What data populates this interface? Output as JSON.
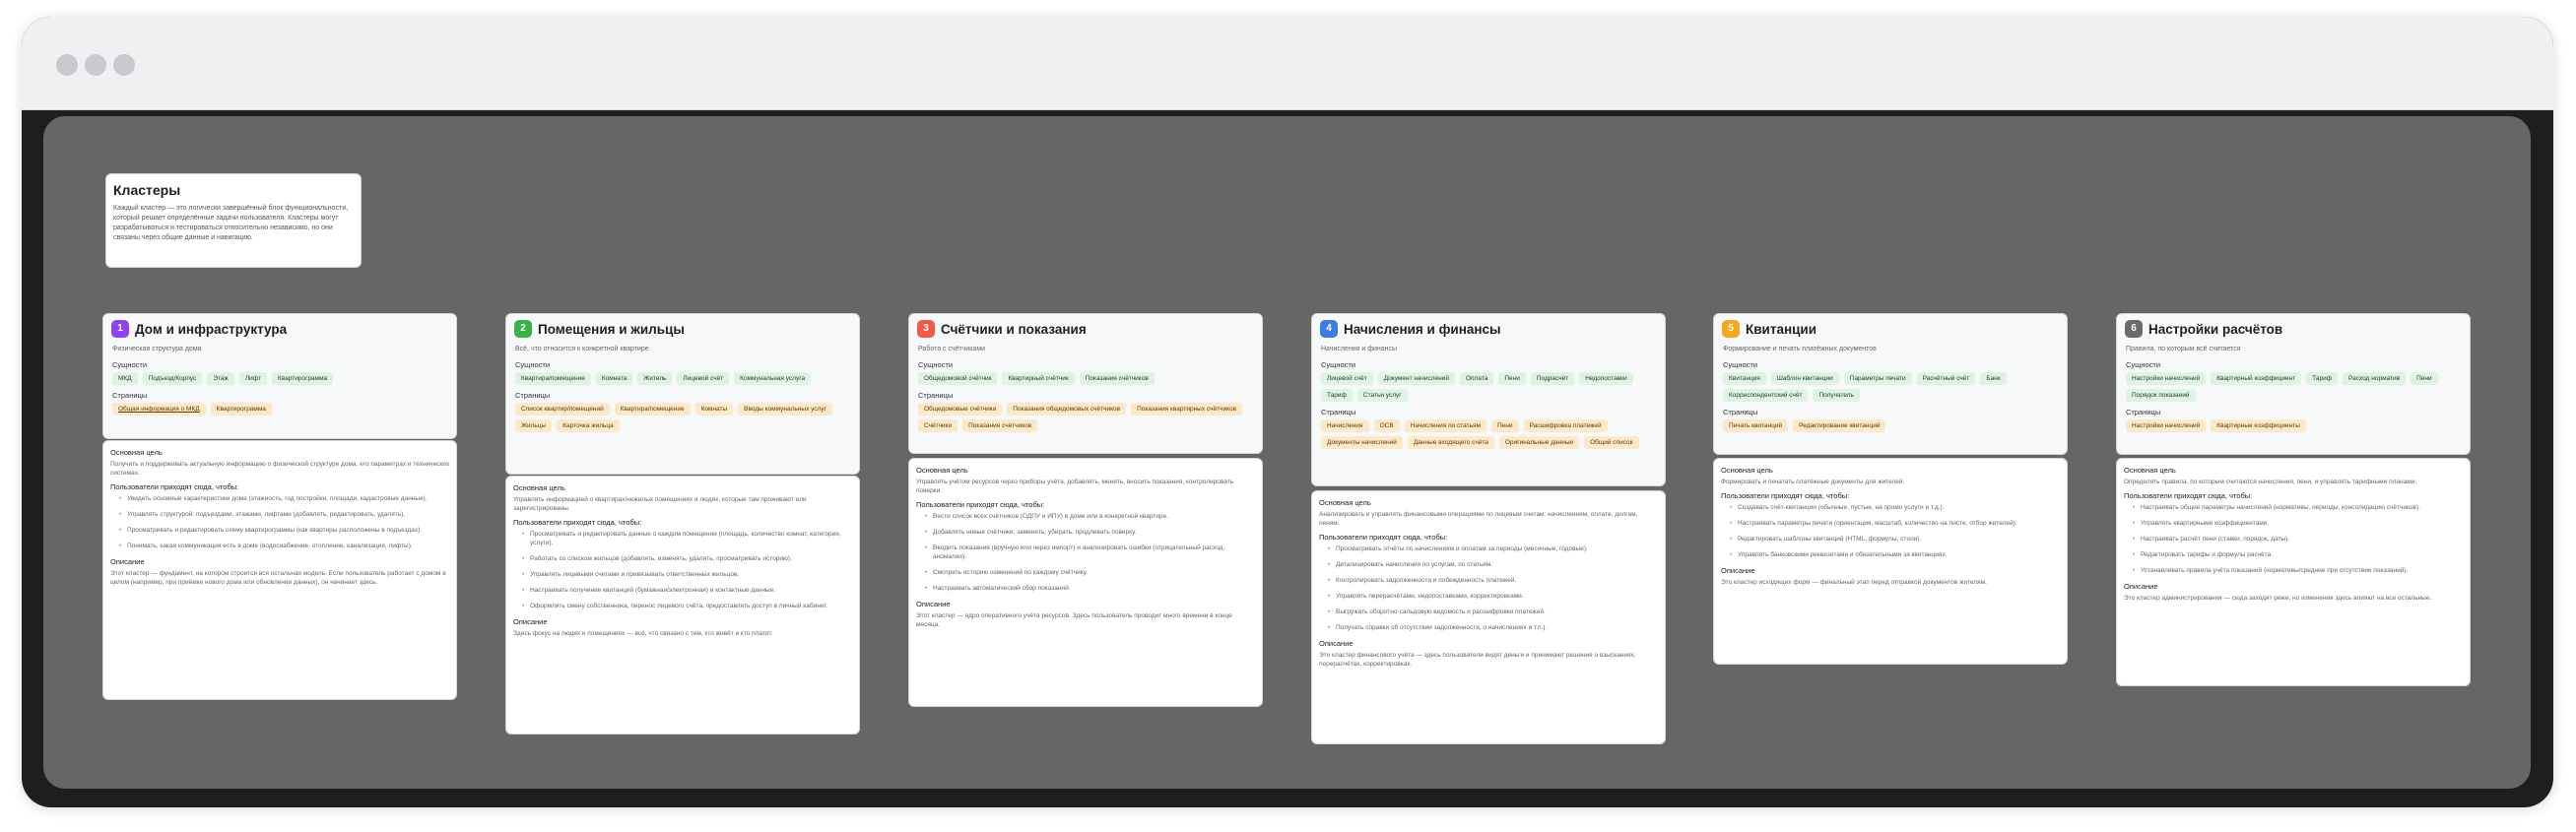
{
  "intro": {
    "title": "Кластеры",
    "text": "Каждый кластер — это логически завершённый блок функциональности, который решает определённые задачи пользователя. Кластеры могут разрабатываться и тестироваться относительно независимо, но они связаны через общие данные и навигацию."
  },
  "labels": {
    "entities": "Сущности",
    "pages": "Страницы",
    "goal": "Основная цель",
    "user_flows": "Пользователи приходят сюда, чтобы:",
    "description": "Описание"
  },
  "colors": {
    "c1": "#8e44ef",
    "c2": "#38b24a",
    "c3": "#ee5b47",
    "c4": "#3d7be5",
    "c5": "#f5a623",
    "c6": "#6b6b6b",
    "green_tag": "#dff3e2",
    "orange_tag": "#fde8c7",
    "canvas": "#666666"
  },
  "clusters": [
    {
      "num": "1",
      "title": "Дом и инфраструктура",
      "subtitle": "Физическая структура дома",
      "entities": [
        "МКД",
        "Подъезд/Корпус",
        "Этаж",
        "Лифт",
        "Квартирограмма"
      ],
      "pages": [
        "Общая информация о МКД",
        "Квартирограмма"
      ],
      "goal": "Получить и поддерживать актуальную информацию о физической структуре дома, его параметрах и технических системах.",
      "flows": [
        "Увидеть основные характеристики дома (этажность, год постройки, площади, кадастровые данные).",
        "Управлять структурой: подъездами, этажами, лифтами (добавлять, редактировать, удалять).",
        "Просматривать и редактировать схему квартирограммы (как квартиры расположены в подъездах).",
        "Понимать, какая коммуникация есть в доме (водоснабжение, отопление, канализация, лифты)."
      ],
      "description": "Этот кластер — фундамент, на котором строится вся остальная модель. Если пользователь работает с домом в целом (например, при приёмке нового дома или обновлении данных), он начинает здесь."
    },
    {
      "num": "2",
      "title": "Помещения и жильцы",
      "subtitle": "Всё, что относится к конкретной квартире",
      "entities": [
        "Квартира/помещение",
        "Комната",
        "Житель",
        "Лицевой счёт",
        "Коммунальная услуга"
      ],
      "pages": [
        "Список квартир/помещений",
        "Квартира/помещение",
        "Комнаты",
        "Вводы коммунальных услуг",
        "Жильцы",
        "Карточка жильца"
      ],
      "goal": "Управлять информацией о квартирах/нежилых помещениях и людях, которые там проживают или зарегистрированы.",
      "flows": [
        "Просматривать и редактировать данные о каждом помещении (площадь, количество комнат, категория, услуги).",
        "Работать со списком жильцов (добавлять, изменять, удалять, просматривать историю).",
        "Управлять лицевыми счетами и привязывать ответственных жильцов.",
        "Настраивать получение квитанций (бумажная/электронная) и контактные данные.",
        "Оформлять смену собственника, перенос лицевого счёта, предоставлять доступ в личный кабинет."
      ],
      "description": "Здесь фокус на людях и помещениях — всё, что связано с тем, кто живёт и кто платит."
    },
    {
      "num": "3",
      "title": "Счётчики и показания",
      "subtitle": "Работа с счётчиками",
      "entities": [
        "Общедомовой счётчик",
        "Квартирный счётчик",
        "Показания счётчиков"
      ],
      "pages": [
        "Общедомовые счётчики",
        "Показания общедомовых счётчиков",
        "Показания квартирных счётчиков",
        "Счётчики",
        "Показания счётчиков"
      ],
      "goal": "Управлять учётом ресурсов через приборы учёта, добавлять, менять, вносить показания, контролировать поверки.",
      "flows": [
        "Вести список всех счётчиков (ОДПУ и ИПУ) в доме или в конкретной квартире.",
        "Добавлять новые счётчики, заменять, убирать, продлевать поверку.",
        "Вводить показания (вручную или через импорт) и анализировать ошибки (отрицательный расход, аномалии).",
        "Смотреть историю изменений по каждому счётчику.",
        "Настраивать автоматический сбор показаний."
      ],
      "description": "Этот кластер — ядро оперативного учёта ресурсов. Здесь пользователь проводит много времени в конце месяца."
    },
    {
      "num": "4",
      "title": "Начисления и финансы",
      "subtitle": "Начисления и финансы",
      "entities": [
        "Лицевой счёт",
        "Документ начислений",
        "Оплата",
        "Пени",
        "Подрасчёт",
        "Недопоставки",
        "Тариф",
        "Статьи услуг"
      ],
      "pages": [
        "Начисления",
        "ОСВ",
        "Начисления по статьям",
        "Пени",
        "Расшифровка платежей",
        "Документы начислений",
        "Данные входящего счёта",
        "Оригинальные данные",
        "Общий список"
      ],
      "goal": "Анализировать и управлять финансовыми операциями по лицевым счетам: начислениям, оплате, долгам, пеням.",
      "flows": [
        "Просматривать отчёты по начислениям и оплатам за периоды (месячные, годовые).",
        "Детализировать начисления по услугам, по статьям.",
        "Контролировать задолженности и побежденность платежей.",
        "Управлять перерасчётами, недопоставками, корректировками.",
        "Выгружать оборотно-сальдовую ведомость и расшифровки платежей.",
        "Получать справки об отсутствии задолженности, о начислениях и т.п.)."
      ],
      "description": "Это кластер финансового учёта — здесь пользователи видят деньги и принимают решения о взысканиях, перерасчётах, корректировках."
    },
    {
      "num": "5",
      "title": "Квитанции",
      "subtitle": "Формирование и печать платёжных документов",
      "entities": [
        "Квитанция",
        "Шаблон квитанции",
        "Параметры печати",
        "Расчётный счёт",
        "Банк",
        "Корреспондентский счёт",
        "Получатель"
      ],
      "pages": [
        "Печать квитанций",
        "Редактирование квитанций"
      ],
      "goal": "Формировать и печатать платёжные документы для жителей.",
      "flows": [
        "Создавать счёт-квитанции (обычные, пустые, на промо услуги и т.д.).",
        "Настраивать параметры печати (ориентация, масштаб, количество на листе, отбор жителей).",
        "Редактировать шаблоны квитанций (HTML, формулы, стили).",
        "Управлять банковскими реквизитами и обязательными за квитанциях."
      ],
      "description": "Это кластер исходящих форм — финальный этап перед отправкой документов жителям."
    },
    {
      "num": "6",
      "title": "Настройки расчётов",
      "subtitle": "Правила, по которым всё считается",
      "entities": [
        "Настройки начислений",
        "Квартирный коэффициент",
        "Тариф",
        "Расход норматив",
        "Пени",
        "Порядок показаний"
      ],
      "pages": [
        "Настройки начислений",
        "Квартирные коэффициенты"
      ],
      "goal": "Определять правила, по которым считаются начисления, пени, и управлять тарифными планами.",
      "flows": [
        "Настраивать общие параметры начислений (нормативы, периоды, консолидацию счётчиков).",
        "Управлять квартирными коэффициентами.",
        "Настраивать расчёт пени (ставки, порядок, даты).",
        "Редактировать тарифы и формулы расчёта.",
        "Устанавливать правила учёта показаний (нормативы/средние при отсутствии показаний)."
      ],
      "description": "Это кластер администрирования — сюда заходят реже, но изменения здесь влияют на все остальные."
    }
  ]
}
